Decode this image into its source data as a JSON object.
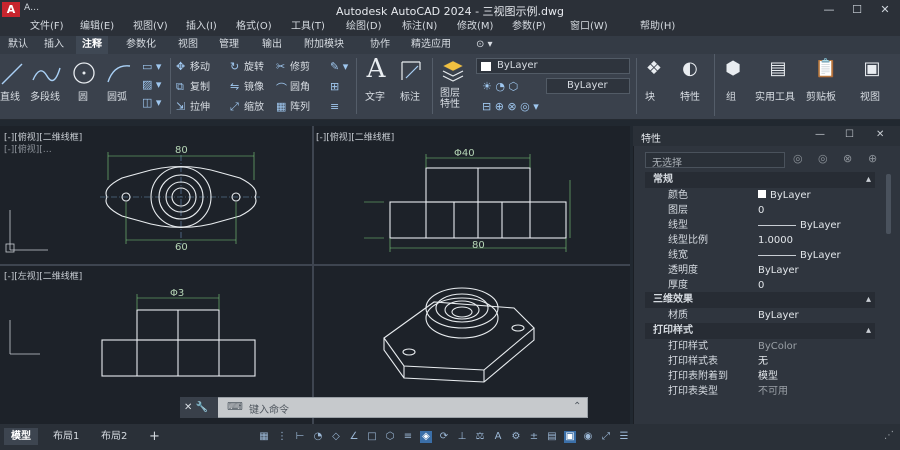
{
  "app": {
    "title": "Autodesk AutoCAD 2024 - 三视图示例.dwg",
    "doc_caption": "A…",
    "logo_text": "A"
  },
  "window_controls": {
    "minimize": "—",
    "maximize": "☐",
    "close": "✕"
  },
  "menu": [
    "文件(F)",
    "编辑(E)",
    "视图(V)",
    "插入(I)",
    "格式(O)",
    "工具(T)",
    "绘图(D)",
    "标注(N)",
    "修改(M)",
    "参数(P)",
    "窗口(W)",
    "帮助(H)"
  ],
  "ribbon_tabs": [
    {
      "label": "默认",
      "active": false
    },
    {
      "label": "插入",
      "active": false
    },
    {
      "label": "注释",
      "active": true
    },
    {
      "label": "参数化",
      "active": false
    },
    {
      "label": "视图",
      "active": false
    },
    {
      "label": "管理",
      "active": false
    },
    {
      "label": "输出",
      "active": false
    },
    {
      "label": "附加模块",
      "active": false
    },
    {
      "label": "协作",
      "active": false
    },
    {
      "label": "精选应用",
      "active": false
    }
  ],
  "ribbon": {
    "draw_tools": [
      "直线",
      "多段线",
      "圆",
      "圆弧"
    ],
    "modify_tools": [
      [
        "移动",
        "旋转",
        "修剪"
      ],
      [
        "复制",
        "镜像",
        "圆角"
      ],
      [
        "拉伸",
        "缩放",
        "阵列"
      ]
    ],
    "annotation_tools": [
      "文字",
      "标注"
    ],
    "layer_tool": "图层特性",
    "layer_dropdowns": [
      "ByLayer",
      "ByLayer"
    ],
    "right_tools": [
      "块",
      "特性",
      "组",
      "实用工具",
      "剪贴板",
      "视图"
    ]
  },
  "viewports": [
    {
      "label": "[-][俯视][二维线框]",
      "sub": "[-][俯视][…"
    },
    {
      "label": "[-][俯视][二维线框]"
    },
    {
      "label": "[-][左视][二维线框]"
    },
    {
      "label": ""
    }
  ],
  "dimensions": {
    "top_view_width": "80",
    "top_view_bottom": "60",
    "front_diameter": "Φ40",
    "front_width": "80",
    "left_view_top": "Φ3"
  },
  "command_line": {
    "handle": "✕ 🔧",
    "placeholder": "键入命令"
  },
  "layout_tabs": [
    {
      "label": "模型",
      "active": true
    },
    {
      "label": "布局1",
      "active": false
    },
    {
      "label": "布局2",
      "active": false
    }
  ],
  "add_layout": "+",
  "properties": {
    "title": "特性",
    "selection": "无选择",
    "sections": [
      {
        "name": "常规",
        "rows": [
          {
            "name": "颜色",
            "value": "ByLayer",
            "swatch": "#ffffff"
          },
          {
            "name": "图层",
            "value": "0"
          },
          {
            "name": "线型",
            "value": "ByLayer",
            "line": true
          },
          {
            "name": "线型比例",
            "value": "1.0000"
          },
          {
            "name": "线宽",
            "value": "ByLayer",
            "line": true
          },
          {
            "name": "透明度",
            "value": "ByLayer"
          },
          {
            "name": "厚度",
            "value": "0"
          }
        ]
      },
      {
        "name": "三维效果",
        "rows": [
          {
            "name": "材质",
            "value": "ByLayer"
          }
        ]
      },
      {
        "name": "打印样式",
        "rows": [
          {
            "name": "打印样式",
            "value": "ByColor"
          },
          {
            "name": "打印样式表",
            "value": "无"
          },
          {
            "name": "打印表附着到",
            "value": "模型"
          },
          {
            "name": "打印表类型",
            "value": "不可用"
          }
        ]
      }
    ]
  },
  "colors": {
    "accent": "#c8252e",
    "background": "#212830",
    "drawing_line": "#e8ecef",
    "dimension": "#7fcf7f"
  }
}
